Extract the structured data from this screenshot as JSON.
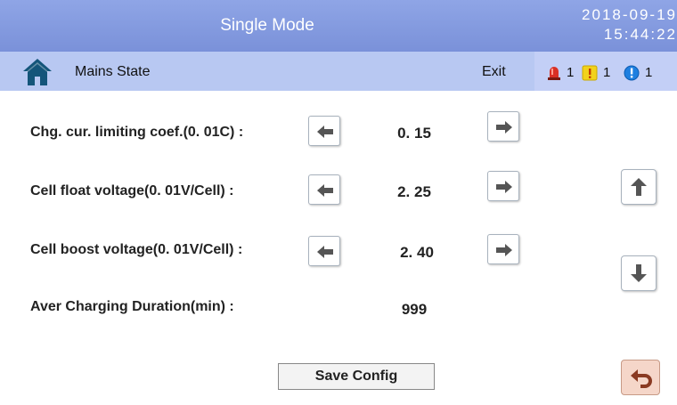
{
  "header": {
    "title": "Single Mode",
    "date": "2018-09-19",
    "time": "15:44:22"
  },
  "nav": {
    "home_icon": "home-icon",
    "title": "Mains State",
    "exit_label": "Exit"
  },
  "alarms": [
    {
      "icon": "siren-icon",
      "count": "1",
      "color": "#d93025"
    },
    {
      "icon": "warning-icon",
      "count": "1",
      "color": "#f2d21b"
    },
    {
      "icon": "info-icon",
      "count": "1",
      "color": "#1e7fe0"
    }
  ],
  "settings": [
    {
      "label": "Chg.  cur. limiting coef.(0. 01C) :",
      "value": "0. 15",
      "adjustable": true
    },
    {
      "label": "Cell float voltage(0. 01V/Cell) :",
      "value": "2. 25",
      "adjustable": true
    },
    {
      "label": "Cell boost voltage(0. 01V/Cell) :",
      "value": "2. 40",
      "adjustable": true
    },
    {
      "label": "Aver Charging Duration(min) :",
      "value": "999",
      "adjustable": false
    }
  ],
  "buttons": {
    "save_label": "Save Config",
    "scroll_up_icon": "arrow-up-icon",
    "scroll_down_icon": "arrow-down-icon",
    "back_icon": "back-arrow-icon"
  },
  "colors": {
    "header_bg": "#8fa5e6",
    "nav_bg": "#b8c8f2",
    "back_button_bg": "#f5d6c9"
  }
}
